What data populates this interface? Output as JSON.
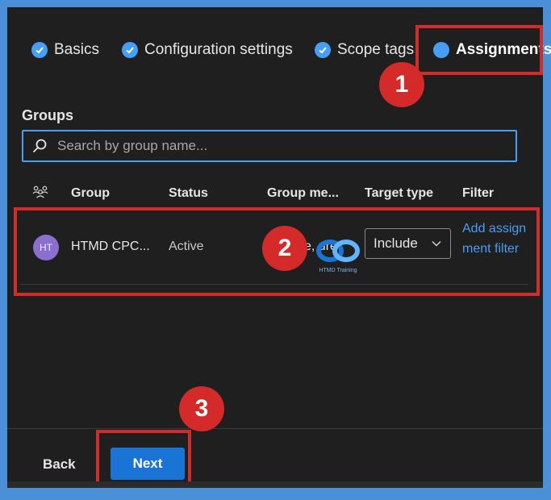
{
  "wizard": {
    "steps": [
      {
        "label": "Basics",
        "state": "complete"
      },
      {
        "label": "Configuration settings",
        "state": "complete"
      },
      {
        "label": "Scope tags",
        "state": "complete"
      },
      {
        "label": "Assignments",
        "state": "current"
      }
    ]
  },
  "groups": {
    "title": "Groups",
    "search_placeholder": "Search by group name...",
    "columns": [
      "Group",
      "Status",
      "Group me...",
      "Target type",
      "Filter"
    ],
    "rows": [
      {
        "avatar": "HT",
        "group": "HTMD CPC...",
        "status": "Active",
        "group_members": "e, ure",
        "target_type": "Include",
        "filter_link": "Add assignment filter"
      }
    ]
  },
  "watermark": {
    "text": "HTMD Training"
  },
  "callouts": [
    "1",
    "2",
    "3"
  ],
  "footer": {
    "back_label": "Back",
    "next_label": "Next"
  },
  "colors": {
    "accent": "#479ef5",
    "highlight": "#d42a2a",
    "primary_button": "#1a74d6",
    "panel_bg": "#1f1f1f"
  }
}
